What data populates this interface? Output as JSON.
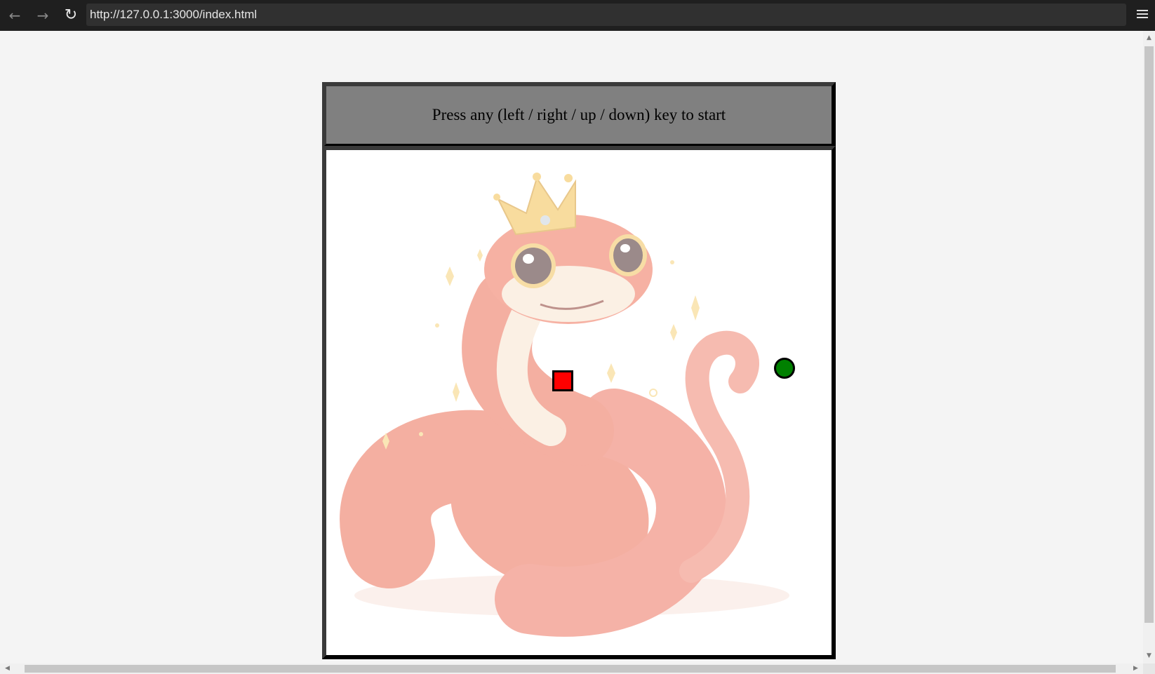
{
  "browser": {
    "url": "http://127.0.0.1:3000/index.html",
    "back_icon": "arrow-left-icon",
    "forward_icon": "arrow-right-icon",
    "reload_icon": "reload-icon",
    "menu_icon": "hamburger-menu-icon"
  },
  "game": {
    "status_message": "Press any (left / right / up / down) key to start",
    "background_art": "crowned-red-snake-illustration",
    "food_color": "#ff0000",
    "snake_head_color": "#008000",
    "header_color": "#808080",
    "board_color": "#ffffff"
  },
  "colors": {
    "toolbar": "#1f1f1f",
    "address_bar": "#303030",
    "page_background": "#f4f4f4"
  }
}
